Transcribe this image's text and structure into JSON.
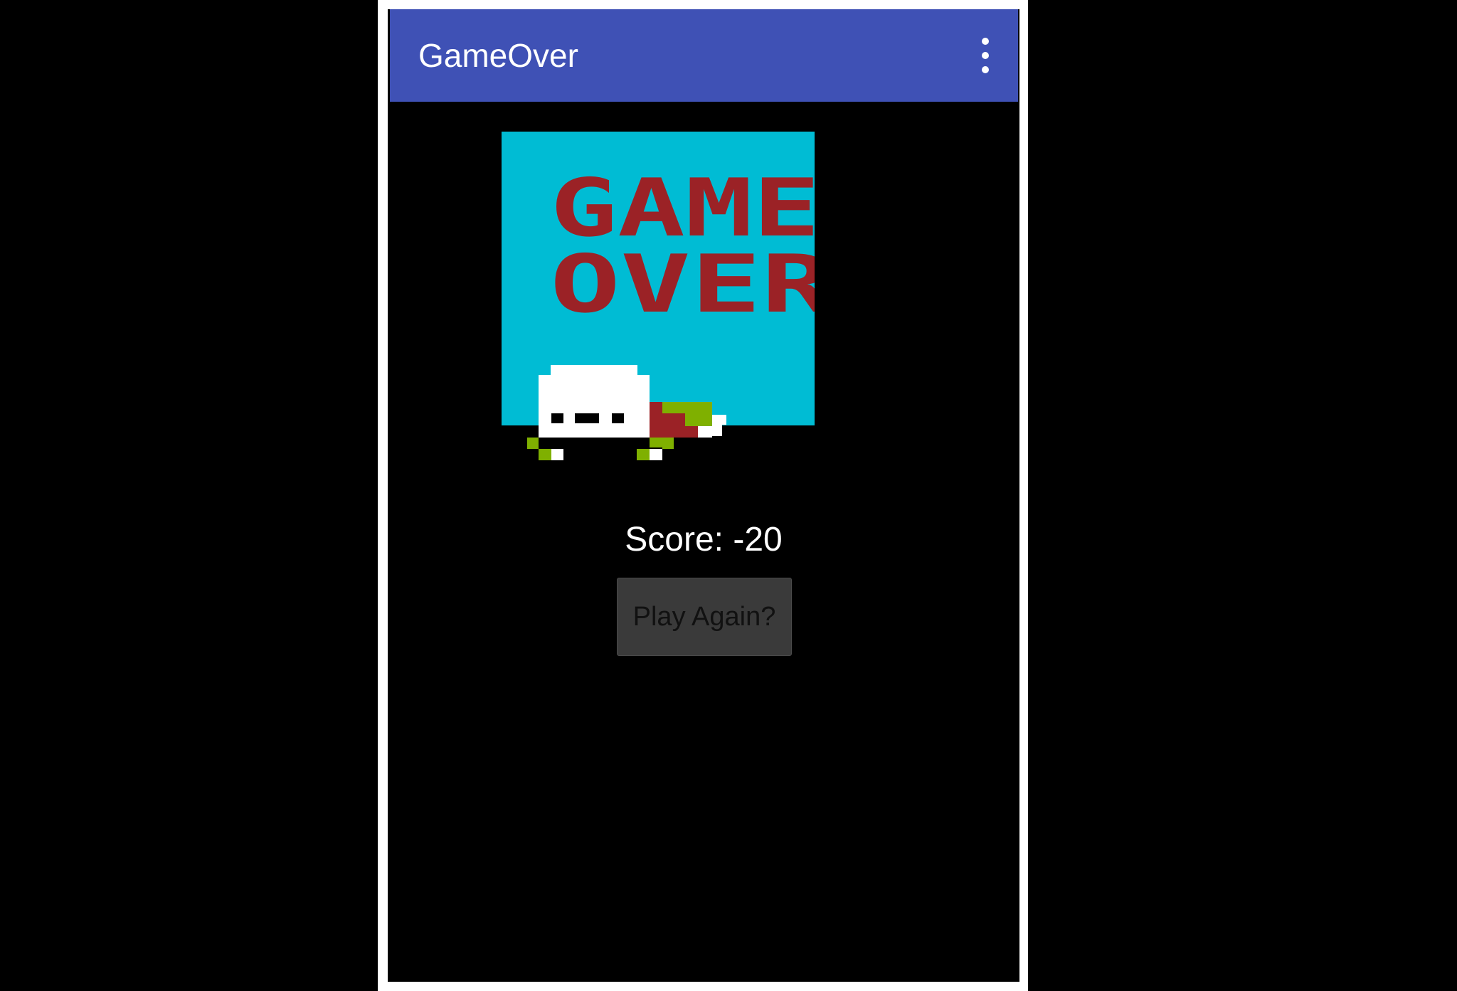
{
  "appbar": {
    "title": "GameOver",
    "overflow_icon": "more-vert-icon",
    "color": "#3f51b5"
  },
  "banner": {
    "line1": "GAME",
    "line2": "OVER",
    "text_color": "#9b2226",
    "background_color": "#00bcd4"
  },
  "score": {
    "text": "Score: -20"
  },
  "actions": {
    "play_again_label": "Play Again?"
  }
}
